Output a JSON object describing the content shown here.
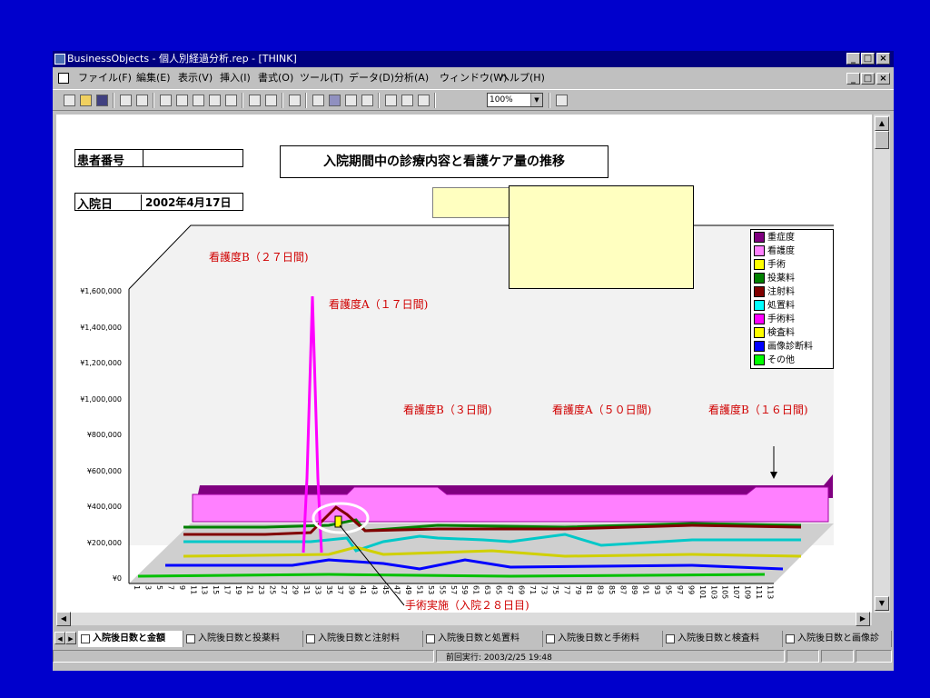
{
  "window": {
    "title": "BusinessObjects - 個人別経過分析.rep - [THINK]",
    "controls": [
      "_",
      "□",
      "×"
    ]
  },
  "menu": {
    "items": [
      "ファイル(F)",
      "編集(E)",
      "表示(V)",
      "挿入(I)",
      "書式(O)",
      "ツール(T)",
      "データ(D)",
      "分析(A)",
      "ウィンドウ(W)",
      "ヘルプ(H)"
    ]
  },
  "toolbar": {
    "zoom": "100%"
  },
  "report": {
    "patient_label": "患者番号",
    "patient_value": "",
    "admission_label": "入院日",
    "admission_value": "2002年4月17日",
    "title": "入院期間中の診療内容と看護ケア量の推移"
  },
  "chart_data": {
    "type": "area",
    "y_ticks": [
      "¥1,600,000",
      "¥1,400,000",
      "¥1,200,000",
      "¥1,000,000",
      "¥800,000",
      "¥600,000",
      "¥400,000",
      "¥200,000",
      "¥0"
    ],
    "ylim": [
      0,
      1600000
    ],
    "x_ticks": [
      "1",
      "3",
      "5",
      "7",
      "9",
      "11",
      "13",
      "15",
      "17",
      "19",
      "21",
      "23",
      "25",
      "27",
      "29",
      "31",
      "33",
      "35",
      "37",
      "39",
      "41",
      "43",
      "45",
      "47",
      "49",
      "51",
      "53",
      "55",
      "57",
      "59",
      "61",
      "63",
      "65",
      "67",
      "69",
      "71",
      "73",
      "75",
      "77",
      "79",
      "81",
      "83",
      "85",
      "87",
      "89",
      "91",
      "93",
      "95",
      "97",
      "99",
      "101",
      "103",
      "105",
      "107",
      "109",
      "111",
      "113"
    ],
    "legend": [
      {
        "name": "重症度",
        "color": "#800080"
      },
      {
        "name": "看護度",
        "color": "#ff80ff"
      },
      {
        "name": "手術",
        "color": "#ffff00"
      },
      {
        "name": "投薬料",
        "color": "#008000"
      },
      {
        "name": "注射料",
        "color": "#800000"
      },
      {
        "name": "処置料",
        "color": "#00ffff"
      },
      {
        "name": "手術料",
        "color": "#ff00ff"
      },
      {
        "name": "検査料",
        "color": "#ffff00"
      },
      {
        "name": "画像診断料",
        "color": "#0000ff"
      },
      {
        "name": "その他",
        "color": "#00ff00"
      }
    ],
    "legend_position": "top-right",
    "annotations": [
      "看護度B（２７日間)",
      "看護度A（１７日間)",
      "看護度B（３日間)",
      "看護度A（５０日間)",
      "看護度B（１６日間)",
      "手術実施（入院２８日目)"
    ]
  },
  "sheet_tabs": [
    "入院後日数と金額",
    "入院後日数と投薬料",
    "入院後日数と注射料",
    "入院後日数と処置料",
    "入院後日数と手術料",
    "入院後日数と検査料",
    "入院後日数と画像診"
  ],
  "status": {
    "last_run": "前回実行: 2003/2/25  19:48"
  }
}
